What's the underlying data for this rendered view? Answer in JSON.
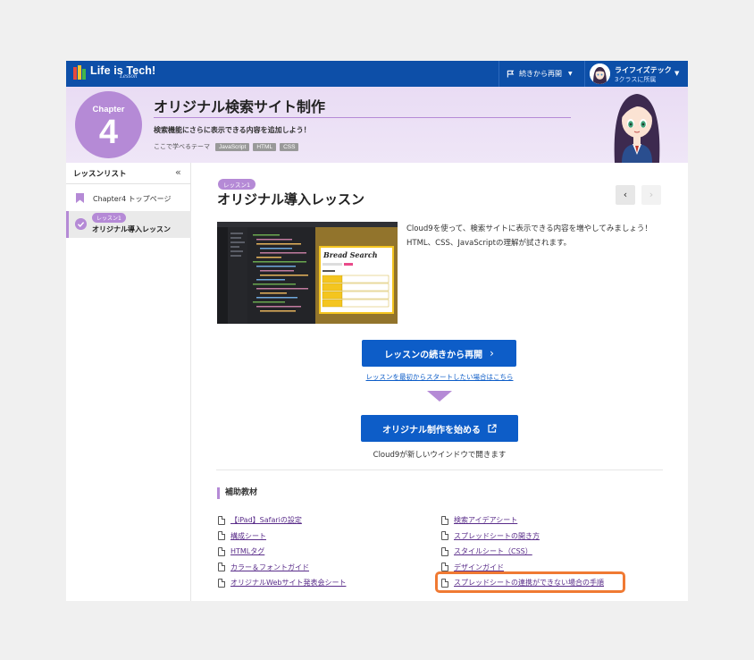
{
  "topbar": {
    "logo_text": "Life is Tech!",
    "logo_sub": "Lesson",
    "resume_label": "続きから再開",
    "user_name": "ライフイズテック",
    "user_class": "3クラスに所属"
  },
  "hero": {
    "chapter_label": "Chapter",
    "chapter_number": "4",
    "title": "オリジナル検索サイト制作",
    "description": "検索機能にさらに表示できる内容を追加しよう！",
    "theme_label": "ここで学べるテーマ",
    "theme_tags": [
      "JavaScript",
      "HTML",
      "CSS"
    ]
  },
  "sidebar": {
    "title": "レッスンリスト",
    "items": [
      {
        "label": "Chapter4 トップページ"
      },
      {
        "tag": "レッスン1",
        "label": "オリジナル導入レッスン"
      }
    ]
  },
  "main": {
    "lesson_tag": "レッスン1",
    "lesson_title": "オリジナル導入レッスン",
    "description": "Cloud9を使って、検索サイトに表示できる内容を増やしてみましょう！ HTML、CSS、JavaScriptの理解が試されます。",
    "resume_button": "レッスンの続きから再開",
    "restart_link": "レッスンを最初からスタートしたい場合はこちら",
    "start_button": "オリジナル制作を始める",
    "start_note": "Cloud9が新しいウインドウで開きます",
    "thumbnail": {
      "title": "Bread Search"
    }
  },
  "materials": {
    "heading": "補助教材",
    "left": [
      "【iPad】Safariの設定",
      "構成シート",
      "HTMLタグ",
      "カラー＆フォントガイド",
      "オリジナルWebサイト発表会シート"
    ],
    "right": [
      "検索アイデアシート",
      "スプレッドシートの開き方",
      "スタイルシート（CSS）",
      "デザインガイド",
      "スプレッドシートの連携ができない場合の手順"
    ]
  },
  "colors": {
    "topbar": "#0d4fa8",
    "accent_purple": "#b58ad6",
    "primary_button": "#0d5dc8",
    "highlight_border": "#f07a33"
  }
}
